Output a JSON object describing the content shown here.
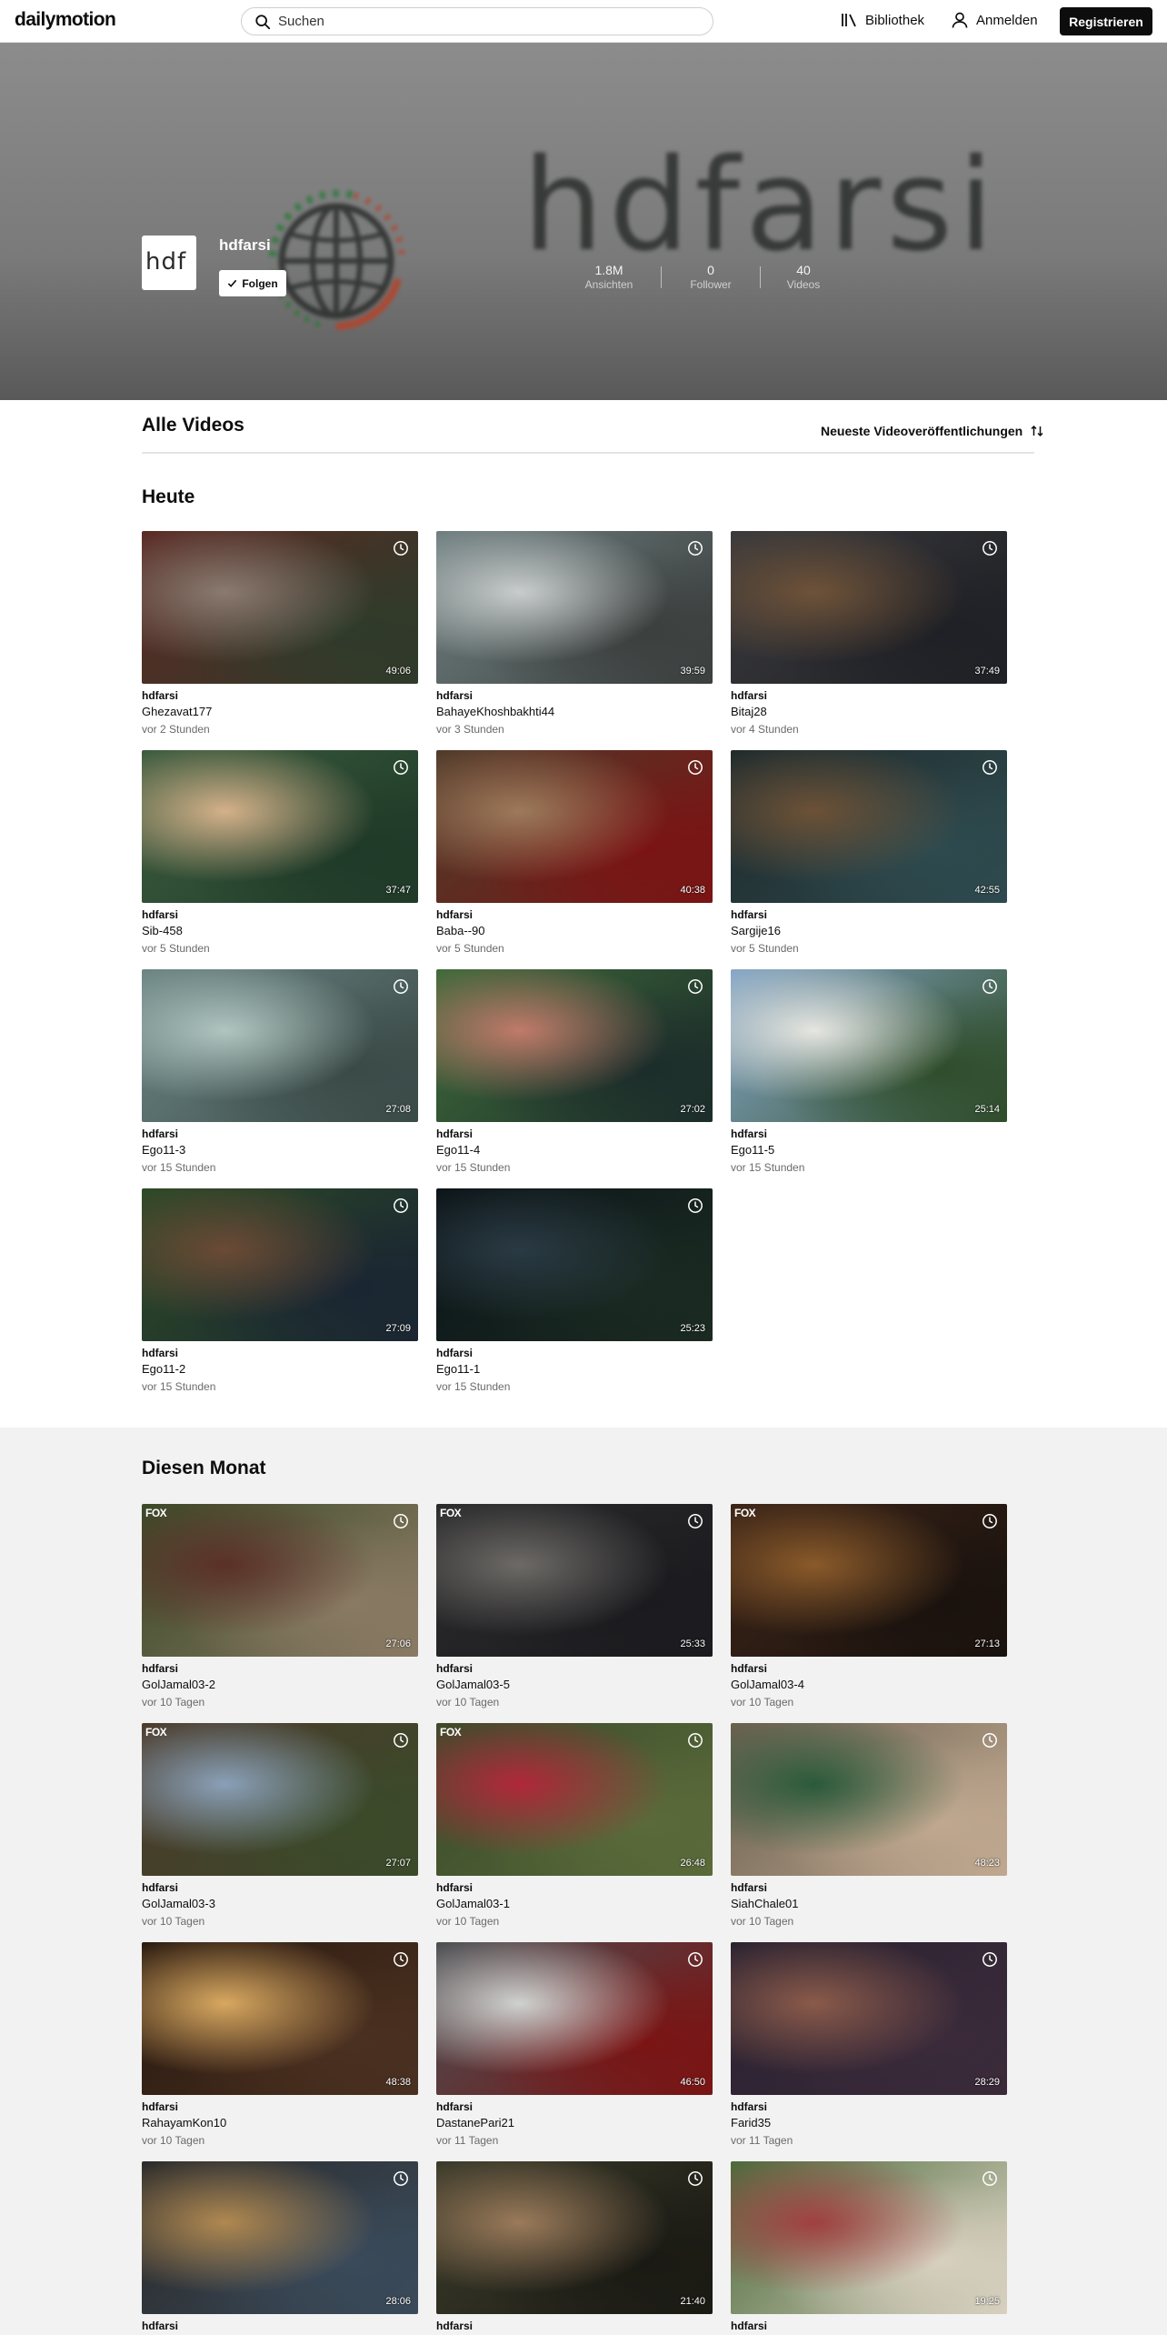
{
  "header": {
    "logo": "dailymotion",
    "search_placeholder": "Suchen",
    "library_label": "Bibliothek",
    "login_label": "Anmelden",
    "register_label": "Registrieren"
  },
  "channel": {
    "name": "hdfarsi",
    "avatar_text": "hdf",
    "banner_text": "hdfarsi",
    "follow_label": "Folgen",
    "stats": [
      {
        "value": "1.8M",
        "label": "Ansichten"
      },
      {
        "value": "0",
        "label": "Follower"
      },
      {
        "value": "40",
        "label": "Videos"
      }
    ]
  },
  "content": {
    "title": "Alle Videos",
    "sort_label": "Neueste Videoveröffentlichungen"
  },
  "sections": [
    {
      "title": "Heute",
      "videos": [
        {
          "channel": "hdfarsi",
          "title": "Ghezavat177",
          "time": "vor 2 Stunden",
          "duration": "49:06",
          "colors": [
            "#5a2a24",
            "#8a7a70",
            "#2f3b2a"
          ]
        },
        {
          "channel": "hdfarsi",
          "title": "BahayeKhoshbakhti44",
          "time": "vor 3 Stunden",
          "duration": "39:59",
          "colors": [
            "#6f7f80",
            "#c8cccc",
            "#3b3f3e"
          ]
        },
        {
          "channel": "hdfarsi",
          "title": "Bitaj28",
          "time": "vor 4 Stunden",
          "duration": "37:49",
          "colors": [
            "#3a3a3d",
            "#6e5238",
            "#1f2025"
          ]
        },
        {
          "channel": "hdfarsi",
          "title": "Sib-458",
          "time": "vor 5 Stunden",
          "duration": "37:47",
          "colors": [
            "#3b5c3e",
            "#d4b18a",
            "#1f3a28"
          ]
        },
        {
          "channel": "hdfarsi",
          "title": "Baba--90",
          "time": "vor 5 Stunden",
          "duration": "40:38",
          "colors": [
            "#4e3b2a",
            "#9d7a5b",
            "#7a1414"
          ]
        },
        {
          "channel": "hdfarsi",
          "title": "Sargije16",
          "time": "vor 5 Stunden",
          "duration": "42:55",
          "colors": [
            "#1f2a2c",
            "#6c5136",
            "#2e4a4e"
          ]
        },
        {
          "channel": "hdfarsi",
          "title": "Ego11-3",
          "time": "vor 15 Stunden",
          "duration": "27:08",
          "colors": [
            "#6c8584",
            "#b0c5c0",
            "#3a4a47"
          ]
        },
        {
          "channel": "hdfarsi",
          "title": "Ego11-4",
          "time": "vor 15 Stunden",
          "duration": "27:02",
          "colors": [
            "#3f6b3a",
            "#c07a6a",
            "#1c2d2a"
          ]
        },
        {
          "channel": "hdfarsi",
          "title": "Ego11-5",
          "time": "vor 15 Stunden",
          "duration": "25:14",
          "colors": [
            "#86a7c7",
            "#e6e6e1",
            "#2f4d2b"
          ]
        },
        {
          "channel": "hdfarsi",
          "title": "Ego11-2",
          "time": "vor 15 Stunden",
          "duration": "27:09",
          "colors": [
            "#2c4a26",
            "#6b4a35",
            "#1a2632"
          ]
        },
        {
          "channel": "hdfarsi",
          "title": "Ego11-1",
          "time": "vor 15 Stunden",
          "duration": "25:23",
          "colors": [
            "#0c1418",
            "#2a3a44",
            "#1a2a22"
          ]
        }
      ]
    },
    {
      "title": "Diesen Monat",
      "videos": [
        {
          "channel": "hdfarsi",
          "title": "GolJamal03-2",
          "time": "vor 10 Tagen",
          "duration": "27:06",
          "colors": [
            "#3b4a28",
            "#5b3028",
            "#8a7a64"
          ],
          "badge": "FOX"
        },
        {
          "channel": "hdfarsi",
          "title": "GolJamal03-5",
          "time": "vor 10 Tagen",
          "duration": "25:33",
          "colors": [
            "#2a2a2c",
            "#6d6a66",
            "#1b1b1f"
          ],
          "badge": "FOX"
        },
        {
          "channel": "hdfarsi",
          "title": "GolJamal03-4",
          "time": "vor 10 Tagen",
          "duration": "27:13",
          "colors": [
            "#3a2418",
            "#8a5a2a",
            "#1a120e"
          ],
          "badge": "FOX"
        },
        {
          "channel": "hdfarsi",
          "title": "GolJamal03-3",
          "time": "vor 10 Tagen",
          "duration": "27:07",
          "colors": [
            "#4b3a2a",
            "#8aa0b8",
            "#3b4a2a"
          ],
          "badge": "FOX"
        },
        {
          "channel": "hdfarsi",
          "title": "GolJamal03-1",
          "time": "vor 10 Tagen",
          "duration": "26:48",
          "colors": [
            "#3a4a2a",
            "#b0283a",
            "#5a6a3a"
          ],
          "badge": "FOX"
        },
        {
          "channel": "hdfarsi",
          "title": "SiahChale01",
          "time": "vor 10 Tagen",
          "duration": "48:23",
          "colors": [
            "#6a6050",
            "#2a5a3a",
            "#c0a890"
          ]
        },
        {
          "channel": "hdfarsi",
          "title": "RahayamKon10",
          "time": "vor 10 Tagen",
          "duration": "48:38",
          "colors": [
            "#2a1a10",
            "#d8a860",
            "#4a3020"
          ]
        },
        {
          "channel": "hdfarsi",
          "title": "DastanePari21",
          "time": "vor 11 Tagen",
          "duration": "46:50",
          "colors": [
            "#4a4e52",
            "#cfd2d0",
            "#7a1414"
          ]
        },
        {
          "channel": "hdfarsi",
          "title": "Farid35",
          "time": "vor 11 Tagen",
          "duration": "28:29",
          "colors": [
            "#2a2230",
            "#8a5a4a",
            "#3a2a3a"
          ]
        },
        {
          "channel": "hdfarsi",
          "title": "",
          "time": "",
          "duration": "28:06",
          "colors": [
            "#2a2a2a",
            "#b08850",
            "#3a4a5a"
          ]
        },
        {
          "channel": "hdfarsi",
          "title": "",
          "time": "",
          "duration": "21:40",
          "colors": [
            "#3a3a2a",
            "#9a7a5a",
            "#1a1a14"
          ]
        },
        {
          "channel": "hdfarsi",
          "title": "",
          "time": "",
          "duration": "19:25",
          "colors": [
            "#4a6a3a",
            "#a04040",
            "#d8d0c0"
          ]
        }
      ]
    }
  ]
}
